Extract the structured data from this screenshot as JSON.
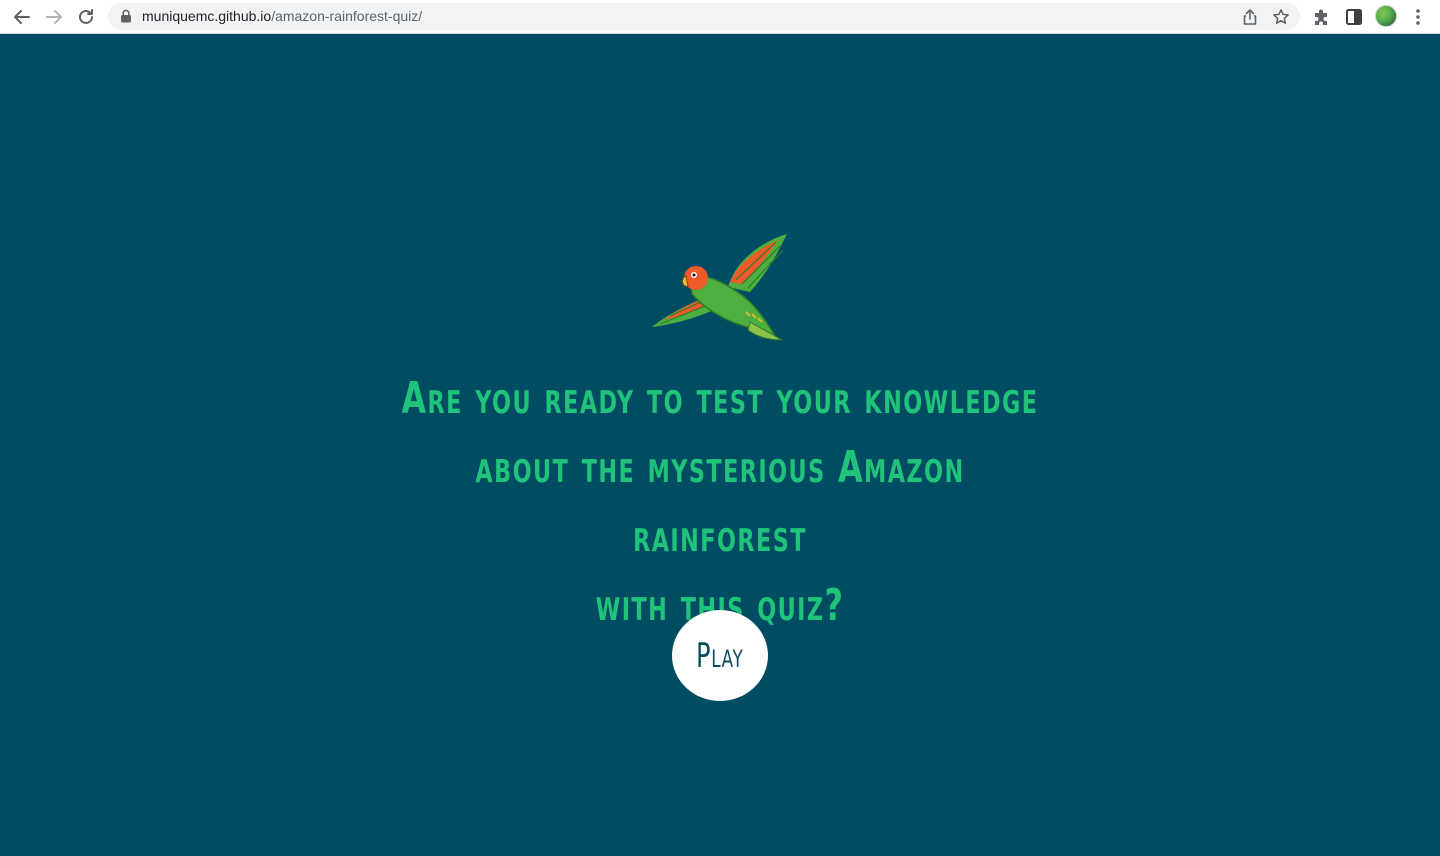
{
  "browser": {
    "url_host": "muniquemc.github.io",
    "url_path": "/amazon-rainforest-quiz/",
    "icons": {
      "back": "back-arrow-icon",
      "forward": "forward-arrow-icon",
      "reload": "reload-icon",
      "lock": "lock-icon",
      "share": "share-icon",
      "bookmark": "star-icon",
      "extensions": "puzzle-icon",
      "side_panel": "side-panel-icon",
      "profile": "avatar",
      "menu": "kebab-menu-icon"
    }
  },
  "page": {
    "background_color": "#004d63",
    "accent_color": "#1fc37a",
    "headline_lines": [
      "Are you ready to test your knowledge",
      "about the mysterious Amazon rainforest",
      "with this quiz?"
    ],
    "play_label": "Play",
    "logo_icon": "parrot-icon"
  }
}
